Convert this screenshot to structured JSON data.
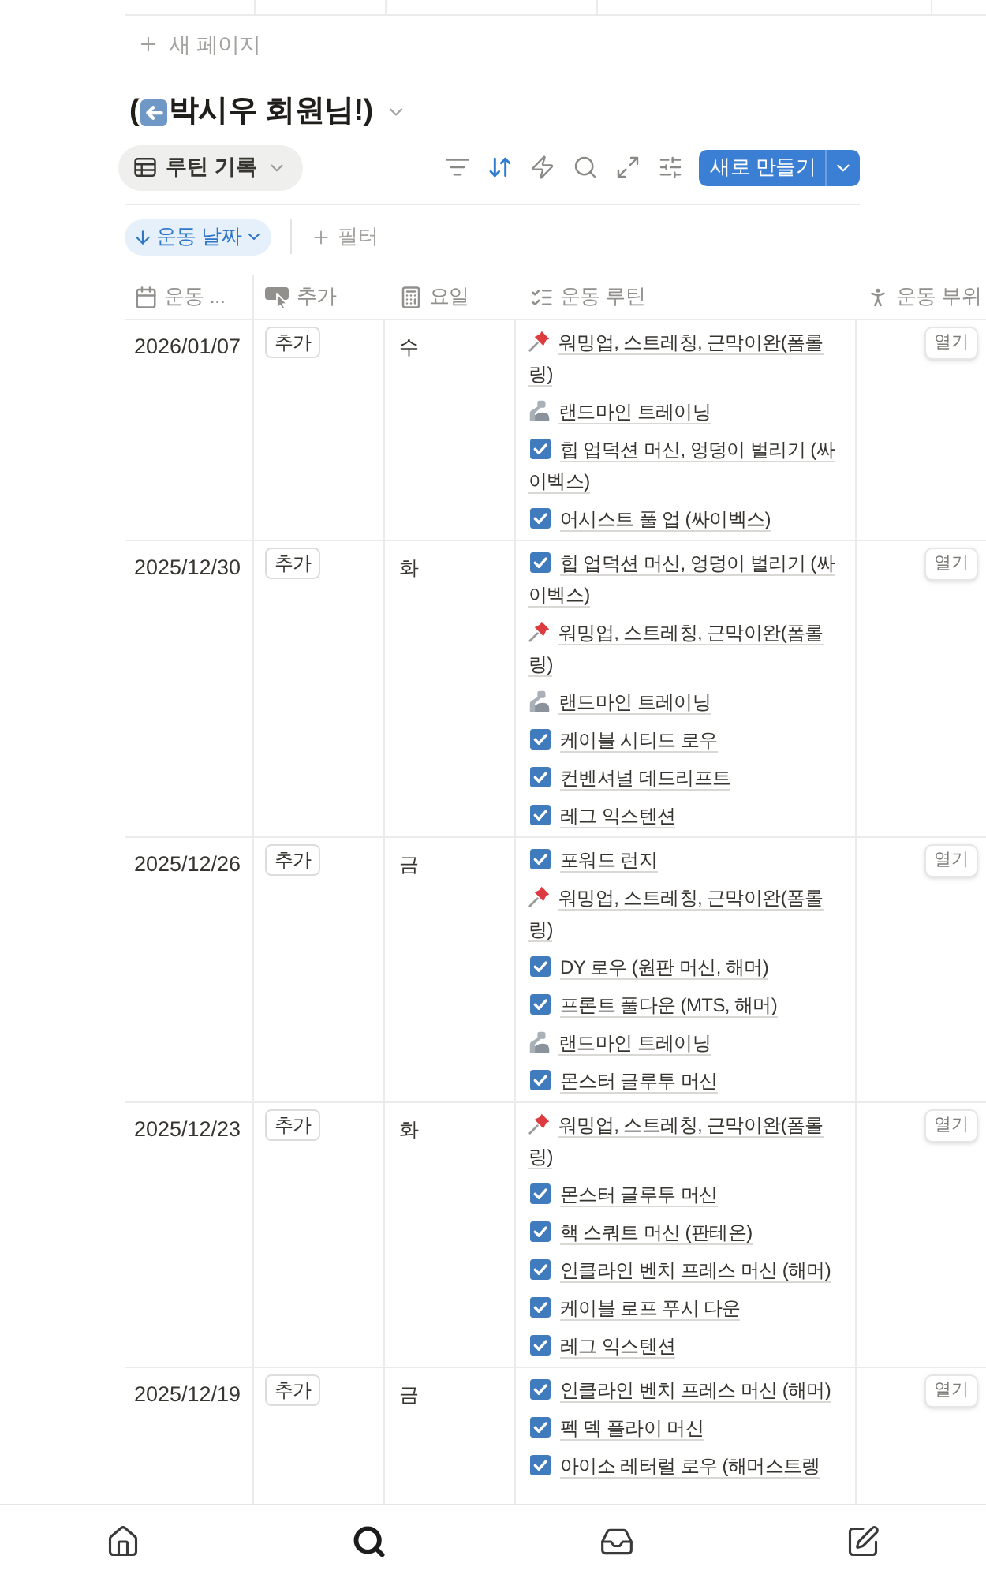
{
  "new_page": {
    "label": "새 페이지"
  },
  "title": {
    "open": "(",
    "text": "박시우 회원님!)"
  },
  "view_tab": {
    "label": "루틴 기록"
  },
  "toolbar_icons": [
    {
      "active": false
    },
    {
      "active": true
    },
    {
      "active": false
    },
    {
      "active": false
    },
    {
      "active": false
    },
    {
      "active": false
    }
  ],
  "new_button": {
    "label": "새로 만들기"
  },
  "sort_chip": {
    "label": "운동 날짜"
  },
  "filter_button": {
    "label": "필터"
  },
  "table": {
    "columns": [
      "운동 ...",
      "추가",
      "요일",
      "운동 루틴",
      "운동 부위"
    ],
    "rows": [
      {
        "date": "2026/01/07",
        "button": "추가",
        "weekday": "수",
        "open": "열기",
        "routines": [
          {
            "kind": "pin",
            "name": "워밍업, 스트레칭, 근막이완(폼롤링)"
          },
          {
            "kind": "arm",
            "name": "랜드마인 트레이닝"
          },
          {
            "kind": "check",
            "name": "힙 업덕션 머신, 엉덩이 벌리기 (싸이벡스)"
          },
          {
            "kind": "check",
            "name": "어시스트 풀 업 (싸이벡스)"
          }
        ]
      },
      {
        "date": "2025/12/30",
        "button": "추가",
        "weekday": "화",
        "open": "열기",
        "routines": [
          {
            "kind": "check",
            "name": "힙 업덕션 머신, 엉덩이 벌리기 (싸이벡스)"
          },
          {
            "kind": "pin",
            "name": "워밍업, 스트레칭, 근막이완(폼롤링)"
          },
          {
            "kind": "arm",
            "name": "랜드마인 트레이닝"
          },
          {
            "kind": "check",
            "name": "케이블 시티드 로우"
          },
          {
            "kind": "check",
            "name": "컨벤셔널 데드리프트"
          },
          {
            "kind": "check",
            "name": "레그 익스텐션"
          }
        ]
      },
      {
        "date": "2025/12/26",
        "button": "추가",
        "weekday": "금",
        "open": "열기",
        "routines": [
          {
            "kind": "check",
            "name": "포워드 런지"
          },
          {
            "kind": "pin",
            "name": "워밍업, 스트레칭, 근막이완(폼롤링)"
          },
          {
            "kind": "check",
            "name": "DY 로우 (원판 머신, 해머)"
          },
          {
            "kind": "check",
            "name": "프론트 풀다운 (MTS, 해머)"
          },
          {
            "kind": "arm",
            "name": "랜드마인 트레이닝"
          },
          {
            "kind": "check",
            "name": "몬스터 글루투 머신"
          }
        ]
      },
      {
        "date": "2025/12/23",
        "button": "추가",
        "weekday": "화",
        "open": "열기",
        "routines": [
          {
            "kind": "pin",
            "name": "워밍업, 스트레칭, 근막이완(폼롤링)"
          },
          {
            "kind": "check",
            "name": "몬스터 글루투 머신"
          },
          {
            "kind": "check",
            "name": "핵 스쿼트 머신 (판테온)"
          },
          {
            "kind": "check",
            "name": "인클라인 벤치 프레스 머신 (해머)"
          },
          {
            "kind": "check",
            "name": "케이블 로프 푸시 다운"
          },
          {
            "kind": "check",
            "name": "레그 익스텐션"
          }
        ]
      },
      {
        "date": "2025/12/19",
        "button": "추가",
        "weekday": "금",
        "open": "열기",
        "routines": [
          {
            "kind": "check",
            "name": "인클라인 벤치 프레스 머신 (해머)"
          },
          {
            "kind": "check",
            "name": "펙 덱 플라이 머신"
          },
          {
            "kind": "check",
            "name": "아이소 레터럴 로우 (해머스트렝"
          }
        ]
      }
    ]
  },
  "bottom_nav": [
    {
      "selected": false
    },
    {
      "selected": true
    },
    {
      "selected": false
    },
    {
      "selected": false
    }
  ]
}
